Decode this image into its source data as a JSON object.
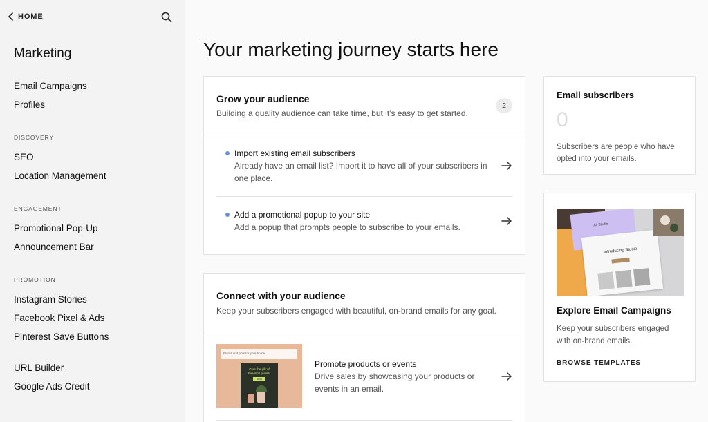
{
  "sidebar": {
    "home_label": "HOME",
    "title": "Marketing",
    "items_top": [
      {
        "label": "Email Campaigns"
      },
      {
        "label": "Profiles"
      }
    ],
    "sections": [
      {
        "label": "DISCOVERY",
        "items": [
          {
            "label": "SEO"
          },
          {
            "label": "Location Management"
          }
        ]
      },
      {
        "label": "ENGAGEMENT",
        "items": [
          {
            "label": "Promotional Pop-Up"
          },
          {
            "label": "Announcement Bar"
          }
        ]
      },
      {
        "label": "PROMOTION",
        "items": [
          {
            "label": "Instagram Stories"
          },
          {
            "label": "Facebook Pixel & Ads"
          },
          {
            "label": "Pinterest Save Buttons"
          }
        ]
      }
    ],
    "items_bottom": [
      {
        "label": "URL Builder"
      },
      {
        "label": "Google Ads Credit"
      }
    ]
  },
  "main": {
    "title": "Your marketing journey starts here",
    "grow": {
      "title": "Grow your audience",
      "subtitle": "Building a quality audience can take time, but it's easy to get started.",
      "badge": "2",
      "tasks": [
        {
          "title": "Import existing email subscribers",
          "desc_line1": "Already have an email list? Import it to have all of your subscribers in",
          "desc_line2": "one place."
        },
        {
          "title": "Add a promotional popup to your site",
          "desc_line1": "Add a popup that prompts people to subscribe to your emails."
        }
      ]
    },
    "connect": {
      "title": "Connect with your audience",
      "subtitle": "Keep your subscribers engaged with beautiful, on-brand emails for any goal.",
      "tasks": [
        {
          "title": "Promote products or events",
          "desc_line1": "Drive sales by showcasing your products or",
          "desc_line2": "events in an email.",
          "thumb_header": "Plants and pots for your home",
          "thumb_headline_1": "Give the gift of",
          "thumb_headline_2": "beautiful plants.",
          "thumb_button": "Shop"
        }
      ]
    },
    "subscribers": {
      "title": "Email subscribers",
      "count": "0",
      "desc_line1": "Subscribers are people who have",
      "desc_line2": "opted into your emails."
    },
    "explore": {
      "title": "Explore Email Campaigns",
      "desc_line1": "Keep your subscribers engaged",
      "desc_line2": "with on-brand emails.",
      "link": "BROWSE TEMPLATES",
      "image_headline": "Introducing Studio",
      "image_caption": "Ali Studio"
    }
  },
  "colors": {
    "sidebar_bg": "#f3f3f3",
    "task_dot": "#6b8fd6",
    "thumb_peach": "#e8b89a",
    "thumb_dark": "#2b3128",
    "thumb_accent": "#c9e36b"
  }
}
